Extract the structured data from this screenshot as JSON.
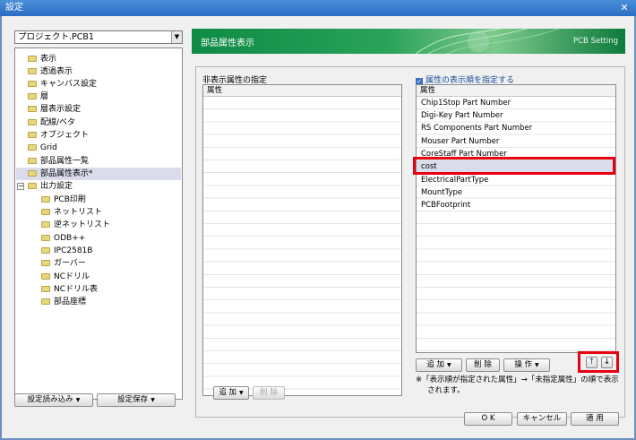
{
  "window": {
    "title": "設定",
    "close": "✕"
  },
  "project": {
    "selected": "プロジェクト.PCB1"
  },
  "tree": [
    {
      "label": "表示"
    },
    {
      "label": "透過表示"
    },
    {
      "label": "キャンバス設定"
    },
    {
      "label": "層"
    },
    {
      "label": "層表示設定"
    },
    {
      "label": "配線/ベタ"
    },
    {
      "label": "オブジェクト"
    },
    {
      "label": "Grid"
    },
    {
      "label": "部品属性一覧"
    },
    {
      "label": "部品属性表示*"
    },
    {
      "label": "出力設定",
      "expander": "−"
    },
    {
      "label": "PCB印刷"
    },
    {
      "label": "ネットリスト"
    },
    {
      "label": "逆ネットリスト"
    },
    {
      "label": "ODB++"
    },
    {
      "label": "IPC2581B"
    },
    {
      "label": "ガーバー"
    },
    {
      "label": "NCドリル"
    },
    {
      "label": "NCドリル表"
    },
    {
      "label": "部品座標"
    }
  ],
  "left_buttons": {
    "load": "設定読み込み",
    "save": "設定保存"
  },
  "banner": {
    "title": "部品属性表示",
    "subtitle": "PCB Setting"
  },
  "hidden_panel": {
    "label": "非表示属性の指定",
    "column": "属性",
    "add": "追 加",
    "delete": "削 除"
  },
  "order_panel": {
    "checkbox_label": "属性の表示順を指定する",
    "checkbox_checked": true,
    "column": "属性",
    "items": [
      "Chip1Stop Part Number",
      "Digi-Key Part Number",
      "RS Components Part Number",
      "Mouser Part Number",
      "CoreStaff Part Number",
      "cost",
      "ElectricalPartType",
      "MountType",
      "PCBFootprint"
    ],
    "selected_item": "cost",
    "add": "追 加",
    "delete": "削 除",
    "operate": "操 作",
    "up": "↑",
    "down": "↓",
    "note_line1": "※「表示順が指定された属性」→「未指定属性」の順で表示",
    "note_line2": "されます。"
  },
  "footer": {
    "ok": "O K",
    "cancel": "キャンセル",
    "apply": "適 用"
  },
  "icons": {
    "dropdown": "▼"
  },
  "colors": {
    "highlight": "#e60012",
    "banner": "#0e8b45",
    "selection": "#dadcec"
  }
}
